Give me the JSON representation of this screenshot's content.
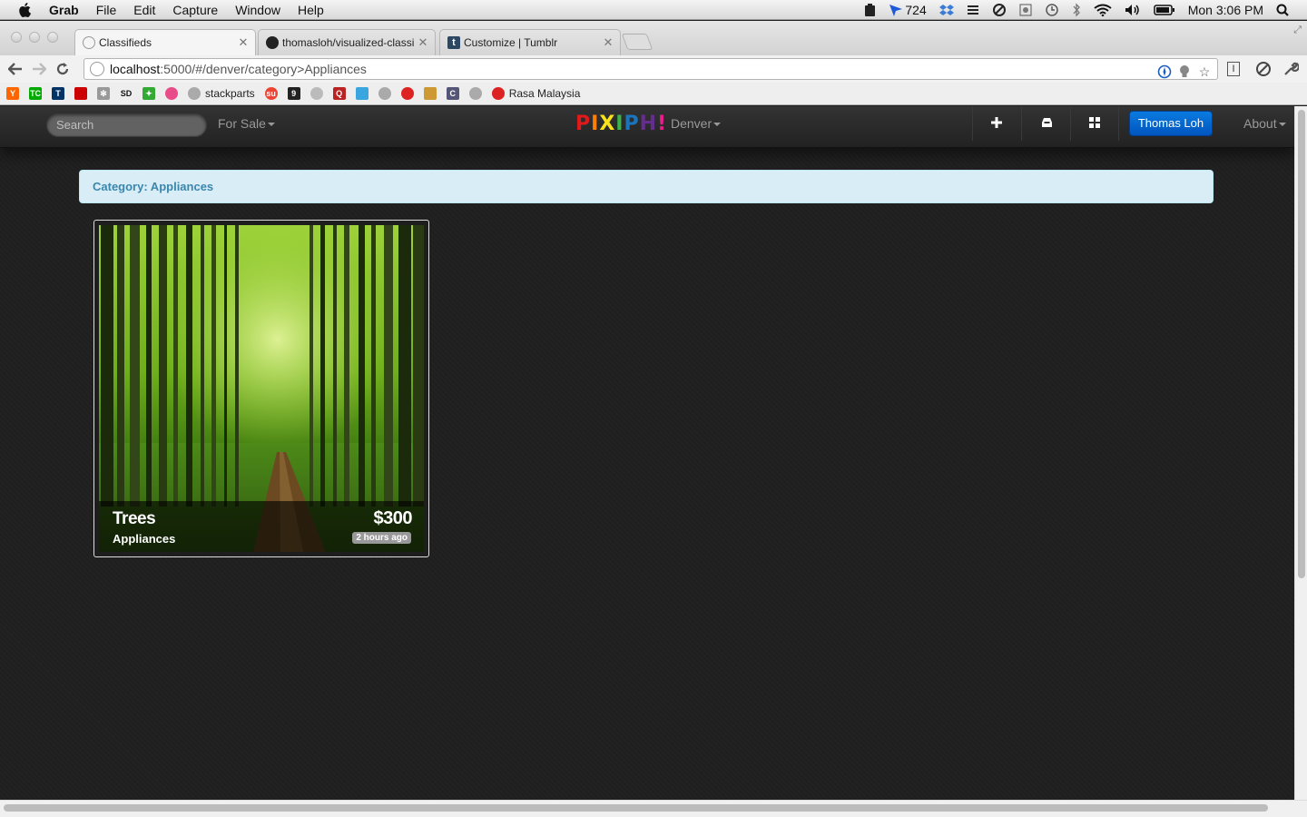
{
  "menubar": {
    "app_name": "Grab",
    "menus": [
      "File",
      "Edit",
      "Capture",
      "Window",
      "Help"
    ],
    "notification_count": "724",
    "clock": "Mon 3:06 PM"
  },
  "tabs": [
    {
      "title": "Classifieds",
      "active": true
    },
    {
      "title": "thomasloh/visualized-classi",
      "active": false
    },
    {
      "title": "Customize | Tumblr",
      "active": false
    }
  ],
  "address": {
    "host": "localhost",
    "path": ":5000/#/denver/category>Appliances"
  },
  "bookmarks": [
    {
      "icon": "y-icon",
      "label": "",
      "color": "#f60"
    },
    {
      "icon": "tc-icon",
      "label": "",
      "color": "#0a0"
    },
    {
      "icon": "t-icon",
      "label": "",
      "color": "#036"
    },
    {
      "icon": "apple-icon",
      "label": "",
      "color": "#c00"
    },
    {
      "icon": "snowflake-icon",
      "label": "",
      "color": "#999"
    },
    {
      "icon": "sd-icon",
      "label": "",
      "color": "#eee"
    },
    {
      "icon": "plant-icon",
      "label": "",
      "color": "#3a3"
    },
    {
      "icon": "dribbble-icon",
      "label": "",
      "color": "#e84c89"
    },
    {
      "icon": "globe-icon",
      "label": "stackparts",
      "color": "#aaa"
    },
    {
      "icon": "stumble-icon",
      "label": "",
      "color": "#e43"
    },
    {
      "icon": "nine-icon",
      "label": "",
      "color": "#222"
    },
    {
      "icon": "reddit-icon",
      "label": "",
      "color": "#bbb"
    },
    {
      "icon": "q-icon",
      "label": "",
      "color": "#b22"
    },
    {
      "icon": "twitter-icon",
      "label": "",
      "color": "#3aa6e0"
    },
    {
      "icon": "mask-icon",
      "label": "",
      "color": "#aaa"
    },
    {
      "icon": "rasa-icon",
      "label": "",
      "color": "#d22"
    },
    {
      "icon": "photo-icon",
      "label": "",
      "color": "#c93"
    },
    {
      "icon": "c-icon",
      "label": "",
      "color": "#557"
    },
    {
      "icon": "globe-icon",
      "label": "",
      "color": "#aaa"
    },
    {
      "icon": "rasa-icon",
      "label": "Rasa Malaysia",
      "color": "#d22"
    }
  ],
  "navbar": {
    "search_placeholder": "Search",
    "for_sale": "For Sale",
    "logo_letters": [
      {
        "ch": "P",
        "color": "#e0191a"
      },
      {
        "ch": "I",
        "color": "#ff7f00"
      },
      {
        "ch": "X",
        "color": "#f7e21c"
      },
      {
        "ch": "I",
        "color": "#39b54a"
      },
      {
        "ch": "P",
        "color": "#1b75bc"
      },
      {
        "ch": "H",
        "color": "#662d91"
      },
      {
        "ch": "!",
        "color": "#ec1c8c"
      }
    ],
    "city": "Denver",
    "user": "Thomas Loh",
    "about": "About"
  },
  "category_bar": "Category: Appliances",
  "listing": {
    "title": "Trees",
    "category": "Appliances",
    "price": "$300",
    "posted": "2 hours ago"
  }
}
